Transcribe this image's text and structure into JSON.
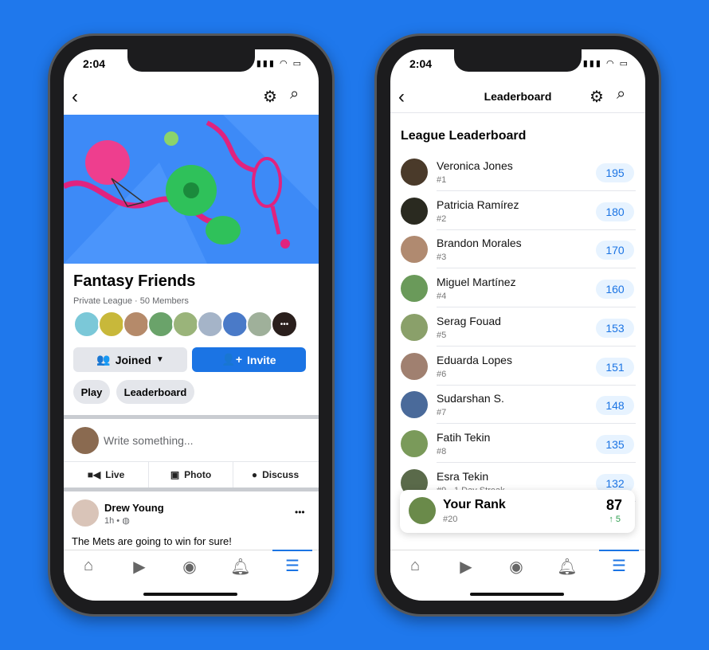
{
  "colors": {
    "background": "#1f78ec",
    "accent": "#1b74e4",
    "score_pill": "#e7f3ff",
    "rank_up": "#2e9e4f"
  },
  "status_bar": {
    "time": "2:04"
  },
  "left": {
    "nav": {
      "back_icon": "chevron-left-icon",
      "settings_icon": "gear-icon",
      "search_icon": "search-icon"
    },
    "group": {
      "title": "Fantasy Friends",
      "subtitle": "Private League · 50 Members",
      "more_members": "•••"
    },
    "buttons": {
      "joined": "Joined",
      "invite": "Invite"
    },
    "chips": [
      "Play",
      "Leaderboard"
    ],
    "composer": {
      "placeholder": "Write something..."
    },
    "actions": [
      "Live",
      "Photo",
      "Discuss"
    ],
    "post": {
      "author": "Drew Young",
      "meta": "1h •",
      "text": "The Mets are going to win for sure!",
      "more": "•••"
    }
  },
  "right": {
    "nav": {
      "title": "Leaderboard"
    },
    "heading": "League Leaderboard",
    "rows": [
      {
        "name": "Veronica Jones",
        "rank": "#1",
        "score": "195"
      },
      {
        "name": "Patricia Ramírez",
        "rank": "#2",
        "score": "180"
      },
      {
        "name": "Brandon Morales",
        "rank": "#3",
        "score": "170"
      },
      {
        "name": "Miguel Martínez",
        "rank": "#4",
        "score": "160"
      },
      {
        "name": "Serag Fouad",
        "rank": "#5",
        "score": "153"
      },
      {
        "name": "Eduarda Lopes",
        "rank": "#6",
        "score": "151"
      },
      {
        "name": "Sudarshan S.",
        "rank": "#7",
        "score": "148"
      },
      {
        "name": "Fatih Tekin",
        "rank": "#8",
        "score": "135"
      },
      {
        "name": "Esra Tekin",
        "rank": "#9 · 1 Day Streak",
        "score": "132"
      }
    ],
    "your_rank": {
      "label": "Your Rank",
      "rank": "#20",
      "score": "87",
      "change": "↑ 5"
    }
  },
  "tabbar": [
    "home-icon",
    "watch-icon",
    "groups-icon",
    "bell-icon",
    "menu-icon"
  ]
}
